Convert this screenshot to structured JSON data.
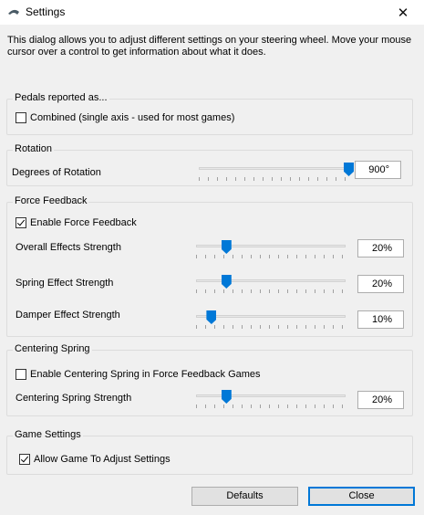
{
  "window": {
    "title": "Settings",
    "close_glyph": "✕"
  },
  "intro": "This dialog allows you to adjust different settings on your steering wheel.  Move your mouse cursor over a control to get information about what it does.",
  "pedals": {
    "legend": "Pedals reported as...",
    "combined": {
      "label": "Combined (single axis - used for most games)",
      "checked": false
    }
  },
  "rotation": {
    "legend": "Rotation",
    "degrees": {
      "label": "Degrees of Rotation",
      "value": "900°",
      "level": 1.0
    }
  },
  "force_feedback": {
    "legend": "Force Feedback",
    "enable": {
      "label": "Enable Force Feedback",
      "checked": true
    },
    "overall": {
      "label": "Overall Effects Strength",
      "value": "20%",
      "level": 0.2
    },
    "spring": {
      "label": "Spring Effect Strength",
      "value": "20%",
      "level": 0.2
    },
    "damper": {
      "label": "Damper Effect Strength",
      "value": "10%",
      "level": 0.1
    }
  },
  "centering": {
    "legend": "Centering Spring",
    "enable": {
      "label": "Enable Centering Spring in Force Feedback Games",
      "checked": false
    },
    "strength": {
      "label": "Centering Spring Strength",
      "value": "20%",
      "level": 0.2
    }
  },
  "game_settings": {
    "legend": "Game Settings",
    "allow": {
      "label": "Allow Game To Adjust Settings",
      "checked": true
    }
  },
  "buttons": {
    "defaults": "Defaults",
    "close": "Close"
  },
  "colors": {
    "accent": "#0078d7"
  }
}
